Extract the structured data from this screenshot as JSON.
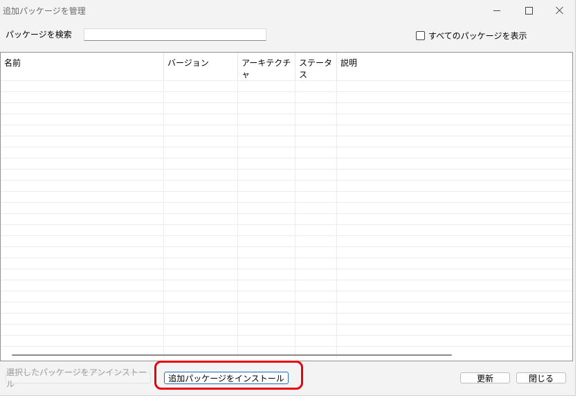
{
  "window": {
    "title": "追加パッケージを管理"
  },
  "search": {
    "label": "パッケージを検索",
    "value": "",
    "placeholder": ""
  },
  "show_all": {
    "label": "すべてのパッケージを表示",
    "checked": false
  },
  "table": {
    "columns": [
      "名前",
      "バージョン",
      "アーキテクチャ",
      "ステータス",
      "説明"
    ],
    "rows": []
  },
  "buttons": {
    "uninstall": "選択したパッケージをアンインストール",
    "install": "追加パッケージをインストール",
    "refresh": "更新",
    "close": "閉じる"
  },
  "colors": {
    "annotation": "#e8000d",
    "primary_border": "#1a6fc0"
  }
}
